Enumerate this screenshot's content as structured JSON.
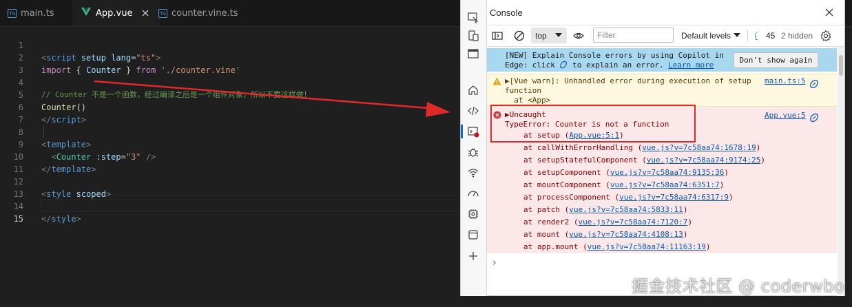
{
  "editor": {
    "tabs": [
      {
        "label": "main.ts",
        "icon": "ts-file-icon",
        "active": false
      },
      {
        "label": "App.vue",
        "icon": "vue-file-icon",
        "active": true
      },
      {
        "label": "counter.vine.ts",
        "icon": "ts-file-icon",
        "active": false
      }
    ],
    "ts_icon_text": "TS",
    "line_numbers": [
      "1",
      "2",
      "3",
      "4",
      "5",
      "6",
      "7",
      "8",
      "9",
      "10",
      "11",
      "12",
      "13",
      "14",
      "15"
    ],
    "code": {
      "l1": {
        "open": "<",
        "tag": "script",
        "attr1": "setup",
        "attr2": "lang",
        "eq": "=",
        "val": "\"ts\"",
        "close": ">"
      },
      "l2": {
        "kw1": "import",
        "brace_open": "{",
        "name": "Counter",
        "brace_close": "}",
        "kw2": "from",
        "path": "'./counter.vine'"
      },
      "l4": {
        "comment": "// Counter 不是一个函数，经过编译之后是一个组件对象，所以不要这样做！"
      },
      "l5": {
        "fn": "Counter",
        "parens": "()"
      },
      "l6": {
        "open": "</",
        "tag": "script",
        "close": ">"
      },
      "l8": {
        "open": "<",
        "tag": "template",
        "close": ">"
      },
      "l9": {
        "open": "<",
        "comp": "Counter",
        "attr": ":step",
        "eq": "=",
        "val": "\"3\"",
        "close": "/>"
      },
      "l10": {
        "open": "</",
        "tag": "template",
        "close": ">"
      },
      "l12": {
        "open": "<",
        "tag": "style",
        "attr": "scoped",
        "close": ">"
      },
      "l14": {
        "open": "</",
        "tag": "style",
        "close": ">"
      }
    }
  },
  "devtools": {
    "title": "Console",
    "toolbar": {
      "context": "top",
      "filter_placeholder": "Filter",
      "levels": "Default levels",
      "issues_count": "45",
      "hidden": "2 hidden"
    },
    "copilot_banner": {
      "text": "[NEW] Explain Console errors by using Copilot in Edge: click",
      "text2": "to explain an error.",
      "learn_more": "Learn more",
      "button": "Don't show again"
    },
    "warning": {
      "text": "▶[Vue warn]: Unhandled error during execution of setup function",
      "sub": "at <App>",
      "source": "main.ts:5"
    },
    "error": {
      "title": "▶Uncaught",
      "message": "TypeError: Counter is not a function",
      "source": "App.vue:5",
      "stack": [
        {
          "fn": "at setup (",
          "loc": "App.vue:5:1",
          "end": ")"
        },
        {
          "fn": "at callWithErrorHandling (",
          "loc": "vue.js?v=7c58aa74:1678:19",
          "end": ")"
        },
        {
          "fn": "at setupStatefulComponent (",
          "loc": "vue.js?v=7c58aa74:9174:25",
          "end": ")"
        },
        {
          "fn": "at setupComponent (",
          "loc": "vue.js?v=7c58aa74:9135:36",
          "end": ")"
        },
        {
          "fn": "at mountComponent (",
          "loc": "vue.js?v=7c58aa74:6351:7",
          "end": ")"
        },
        {
          "fn": "at processComponent (",
          "loc": "vue.js?v=7c58aa74:6317:9",
          "end": ")"
        },
        {
          "fn": "at patch (",
          "loc": "vue.js?v=7c58aa74:5833:11",
          "end": ")"
        },
        {
          "fn": "at render2 (",
          "loc": "vue.js?v=7c58aa74:7120:7",
          "end": ")"
        },
        {
          "fn": "at mount (",
          "loc": "vue.js?v=7c58aa74:4108:13",
          "end": ")"
        },
        {
          "fn": "at app.mount (",
          "loc": "vue.js?v=7c58aa74:11163:19",
          "end": ")"
        }
      ]
    },
    "prompt": "›",
    "colors": {
      "accent": "#0f6cbd",
      "error_bg": "#fce8e8",
      "warn_bg": "#fef8e0",
      "banner_bg": "#a7d8ef",
      "highlight": "#e02a2a"
    }
  },
  "watermark": "掘金技术社区 @ coderwbo"
}
